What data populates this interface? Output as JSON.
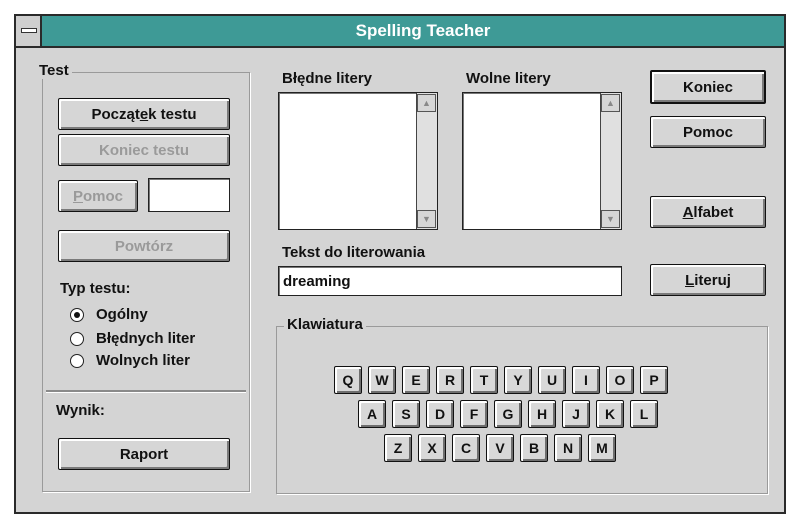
{
  "window": {
    "title": "Spelling Teacher"
  },
  "test_group": {
    "title": "Test",
    "start_label": "Początek testu",
    "end_label": "Koniec testu",
    "help_label": "Pomoc",
    "help_value": "",
    "repeat_label": "Powtórz"
  },
  "test_type": {
    "title": "Typ testu:",
    "options": [
      {
        "label": "Ogólny",
        "selected": true
      },
      {
        "label": "Błędnych liter",
        "selected": false
      },
      {
        "label": "Wolnych liter",
        "selected": false
      }
    ]
  },
  "result": {
    "title": "Wynik:",
    "report_label": "Raport"
  },
  "wrong_letters": {
    "label": "Błędne litery",
    "items": []
  },
  "free_letters": {
    "label": "Wolne litery",
    "items": []
  },
  "spell_text": {
    "label": "Tekst do literowania",
    "value": "dreaming"
  },
  "right_buttons": {
    "end_label": "Koniec",
    "help_label": "Pomoc",
    "alphabet_label": "Alfabet",
    "spell_label": "Literuj"
  },
  "keyboard": {
    "title": "Klawiatura",
    "rows": [
      [
        "Q",
        "W",
        "E",
        "R",
        "T",
        "Y",
        "U",
        "I",
        "O",
        "P"
      ],
      [
        "A",
        "S",
        "D",
        "F",
        "G",
        "H",
        "J",
        "K",
        "L"
      ],
      [
        "Z",
        "X",
        "C",
        "V",
        "B",
        "N",
        "M"
      ]
    ]
  }
}
